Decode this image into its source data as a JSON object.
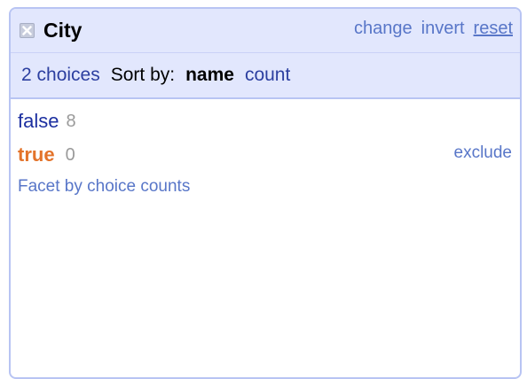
{
  "facet": {
    "name": "City",
    "title_links": {
      "change": "change",
      "invert": "invert",
      "reset": "reset"
    },
    "controls": {
      "choices_count": "2 choices",
      "sort_by_label": "Sort by:",
      "sort_name": "name",
      "sort_count": "count"
    },
    "choices": [
      {
        "label": "false",
        "count": "8"
      },
      {
        "label": "true",
        "count": "0",
        "exclude": "exclude"
      }
    ],
    "facet_by_counts": "Facet by choice counts"
  },
  "colors": {
    "header_bg": "#e2e7fd",
    "border": "#b8c4f3",
    "link": "#5876c8",
    "dark_link": "#2c3fa0",
    "selected_choice": "#e3732a"
  },
  "icons": {
    "close": "close-icon"
  }
}
